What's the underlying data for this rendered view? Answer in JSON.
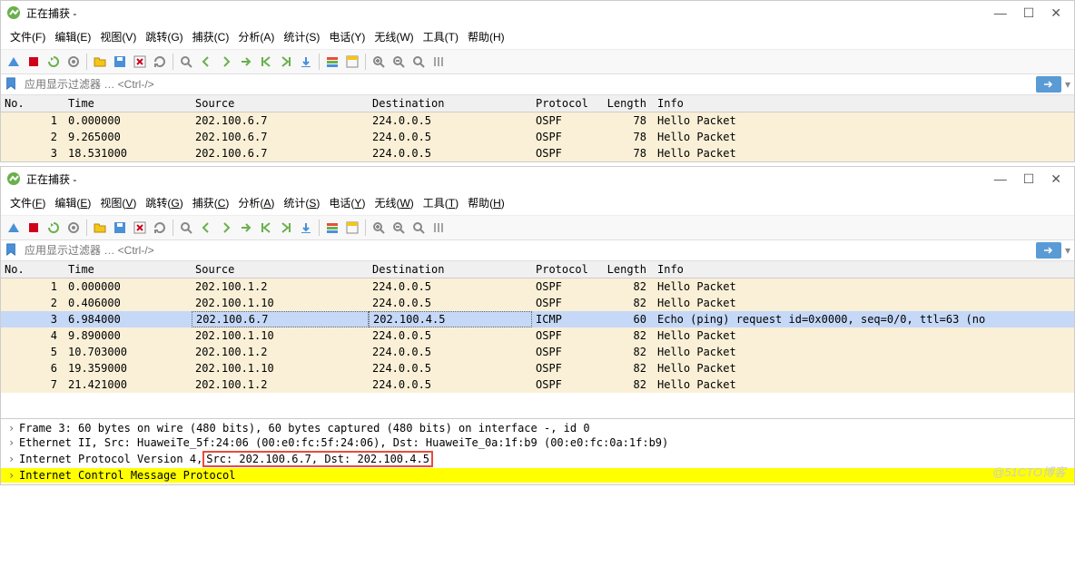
{
  "win1": {
    "title": "正在捕获 -",
    "menu": [
      "文件(F)",
      "编辑(E)",
      "视图(V)",
      "跳转(G)",
      "捕获(C)",
      "分析(A)",
      "统计(S)",
      "电话(Y)",
      "无线(W)",
      "工具(T)",
      "帮助(H)"
    ],
    "filter_placeholder": "应用显示过滤器 … <Ctrl-/>",
    "columns": [
      "No.",
      "Time",
      "Source",
      "Destination",
      "Protocol",
      "Length",
      "Info"
    ],
    "rows": [
      {
        "no": "1",
        "time": "0.000000",
        "src": "202.100.6.7",
        "dst": "224.0.0.5",
        "proto": "OSPF",
        "len": "78",
        "info": "Hello Packet",
        "bg": "cream"
      },
      {
        "no": "2",
        "time": "9.265000",
        "src": "202.100.6.7",
        "dst": "224.0.0.5",
        "proto": "OSPF",
        "len": "78",
        "info": "Hello Packet",
        "bg": "cream"
      },
      {
        "no": "3",
        "time": "18.531000",
        "src": "202.100.6.7",
        "dst": "224.0.0.5",
        "proto": "OSPF",
        "len": "78",
        "info": "Hello Packet",
        "bg": "cream"
      }
    ]
  },
  "win2": {
    "title": "正在捕获 -",
    "menu": [
      "文件(F)",
      "编辑(E)",
      "视图(V)",
      "跳转(G)",
      "捕获(C)",
      "分析(A)",
      "统计(S)",
      "电话(Y)",
      "无线(W)",
      "工具(T)",
      "帮助(H)"
    ],
    "filter_placeholder": "应用显示过滤器 … <Ctrl-/>",
    "columns": [
      "No.",
      "Time",
      "Source",
      "Destination",
      "Protocol",
      "Length",
      "Info"
    ],
    "rows": [
      {
        "no": "1",
        "time": "0.000000",
        "src": "202.100.1.2",
        "dst": "224.0.0.5",
        "proto": "OSPF",
        "len": "82",
        "info": "Hello Packet",
        "bg": "cream"
      },
      {
        "no": "2",
        "time": "0.406000",
        "src": "202.100.1.10",
        "dst": "224.0.0.5",
        "proto": "OSPF",
        "len": "82",
        "info": "Hello Packet",
        "bg": "cream"
      },
      {
        "no": "3",
        "time": "6.984000",
        "src": "202.100.6.7",
        "dst": "202.100.4.5",
        "proto": "ICMP",
        "len": "60",
        "info": "Echo (ping) request  id=0x0000, seq=0/0, ttl=63 (no",
        "bg": "selected"
      },
      {
        "no": "4",
        "time": "9.890000",
        "src": "202.100.1.10",
        "dst": "224.0.0.5",
        "proto": "OSPF",
        "len": "82",
        "info": "Hello Packet",
        "bg": "cream"
      },
      {
        "no": "5",
        "time": "10.703000",
        "src": "202.100.1.2",
        "dst": "224.0.0.5",
        "proto": "OSPF",
        "len": "82",
        "info": "Hello Packet",
        "bg": "cream"
      },
      {
        "no": "6",
        "time": "19.359000",
        "src": "202.100.1.10",
        "dst": "224.0.0.5",
        "proto": "OSPF",
        "len": "82",
        "info": "Hello Packet",
        "bg": "cream"
      },
      {
        "no": "7",
        "time": "21.421000",
        "src": "202.100.1.2",
        "dst": "224.0.0.5",
        "proto": "OSPF",
        "len": "82",
        "info": "Hello Packet",
        "bg": "cream"
      }
    ],
    "details": {
      "frame": "Frame 3: 60 bytes on wire (480 bits), 60 bytes captured (480 bits) on interface -, id 0",
      "eth": "Ethernet II, Src: HuaweiTe_5f:24:06 (00:e0:fc:5f:24:06), Dst: HuaweiTe_0a:1f:b9 (00:e0:fc:0a:1f:b9)",
      "ip_pre": "Internet Protocol Version 4, ",
      "ip_hl": "Src: 202.100.6.7, Dst: 202.100.4.5",
      "icmp": "Internet Control Message Protocol"
    }
  },
  "watermark": "@51CTO博客",
  "win_btns": {
    "min": "—",
    "max": "☐",
    "close": "✕"
  },
  "expand": "›"
}
